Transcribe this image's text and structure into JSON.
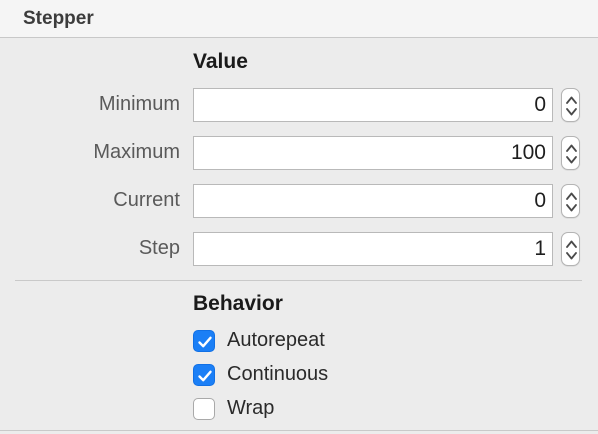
{
  "panel": {
    "title": "Stepper"
  },
  "value_section": {
    "title": "Value",
    "rows": [
      {
        "label": "Minimum",
        "value": "0"
      },
      {
        "label": "Maximum",
        "value": "100"
      },
      {
        "label": "Current",
        "value": "0"
      },
      {
        "label": "Step",
        "value": "1"
      }
    ],
    "stepper_icon": "up-down-chevrons"
  },
  "behavior_section": {
    "title": "Behavior",
    "options": [
      {
        "label": "Autorepeat",
        "checked": true
      },
      {
        "label": "Continuous",
        "checked": true
      },
      {
        "label": "Wrap",
        "checked": false
      }
    ],
    "check_icon": "checkmark"
  },
  "colors": {
    "accent": "#1b7ff6",
    "panel_background": "#ececec",
    "header_background": "#f5f5f5"
  }
}
